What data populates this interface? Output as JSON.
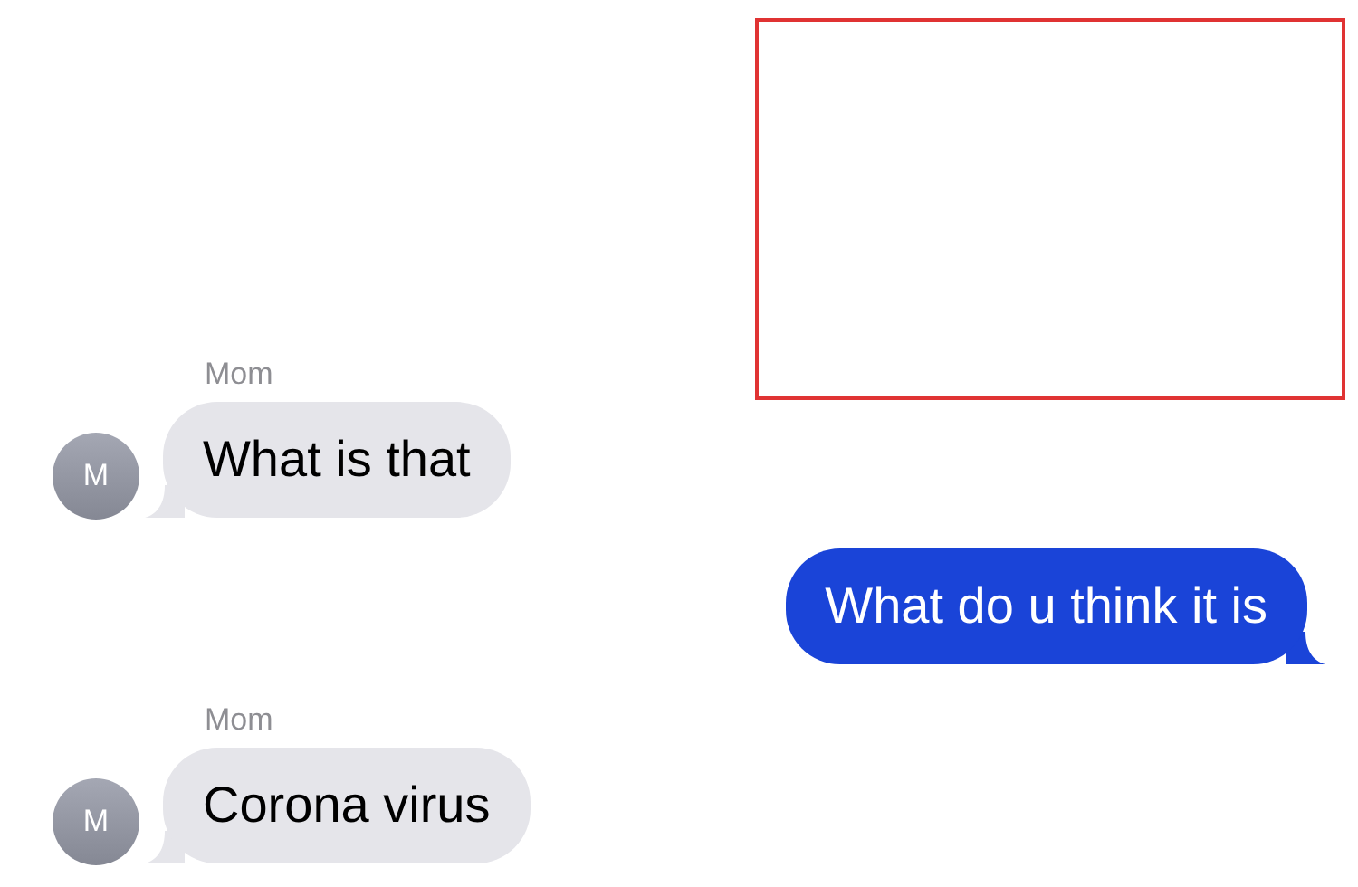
{
  "messages": [
    {
      "kind": "incoming",
      "sender": "Mom",
      "avatar": "M",
      "text": "What is that"
    },
    {
      "kind": "outgoing",
      "text": "What do u think it is"
    },
    {
      "kind": "incoming",
      "sender": "Mom",
      "avatar": "M",
      "text": "Corona virus"
    }
  ],
  "annotations": [
    {
      "kind": "frame"
    }
  ]
}
